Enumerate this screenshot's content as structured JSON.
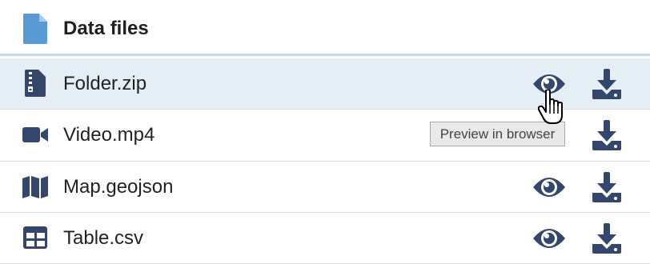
{
  "header": {
    "title": "Data files",
    "icon": "file-icon",
    "icon_color": "#5b9bd5"
  },
  "files": [
    {
      "name": "Folder.zip",
      "icon": "file-archive-icon",
      "selected": true,
      "has_preview": true
    },
    {
      "name": "Video.mp4",
      "icon": "video-icon",
      "selected": false,
      "has_preview": false
    },
    {
      "name": "Map.geojson",
      "icon": "map-icon",
      "selected": false,
      "has_preview": true
    },
    {
      "name": "Table.csv",
      "icon": "table-icon",
      "selected": false,
      "has_preview": true
    }
  ],
  "tooltip": {
    "text": "Preview in browser"
  },
  "colors": {
    "icon": "#34476b",
    "selected_row": "#e6eef5",
    "header_divider": "#c5d9e8"
  }
}
